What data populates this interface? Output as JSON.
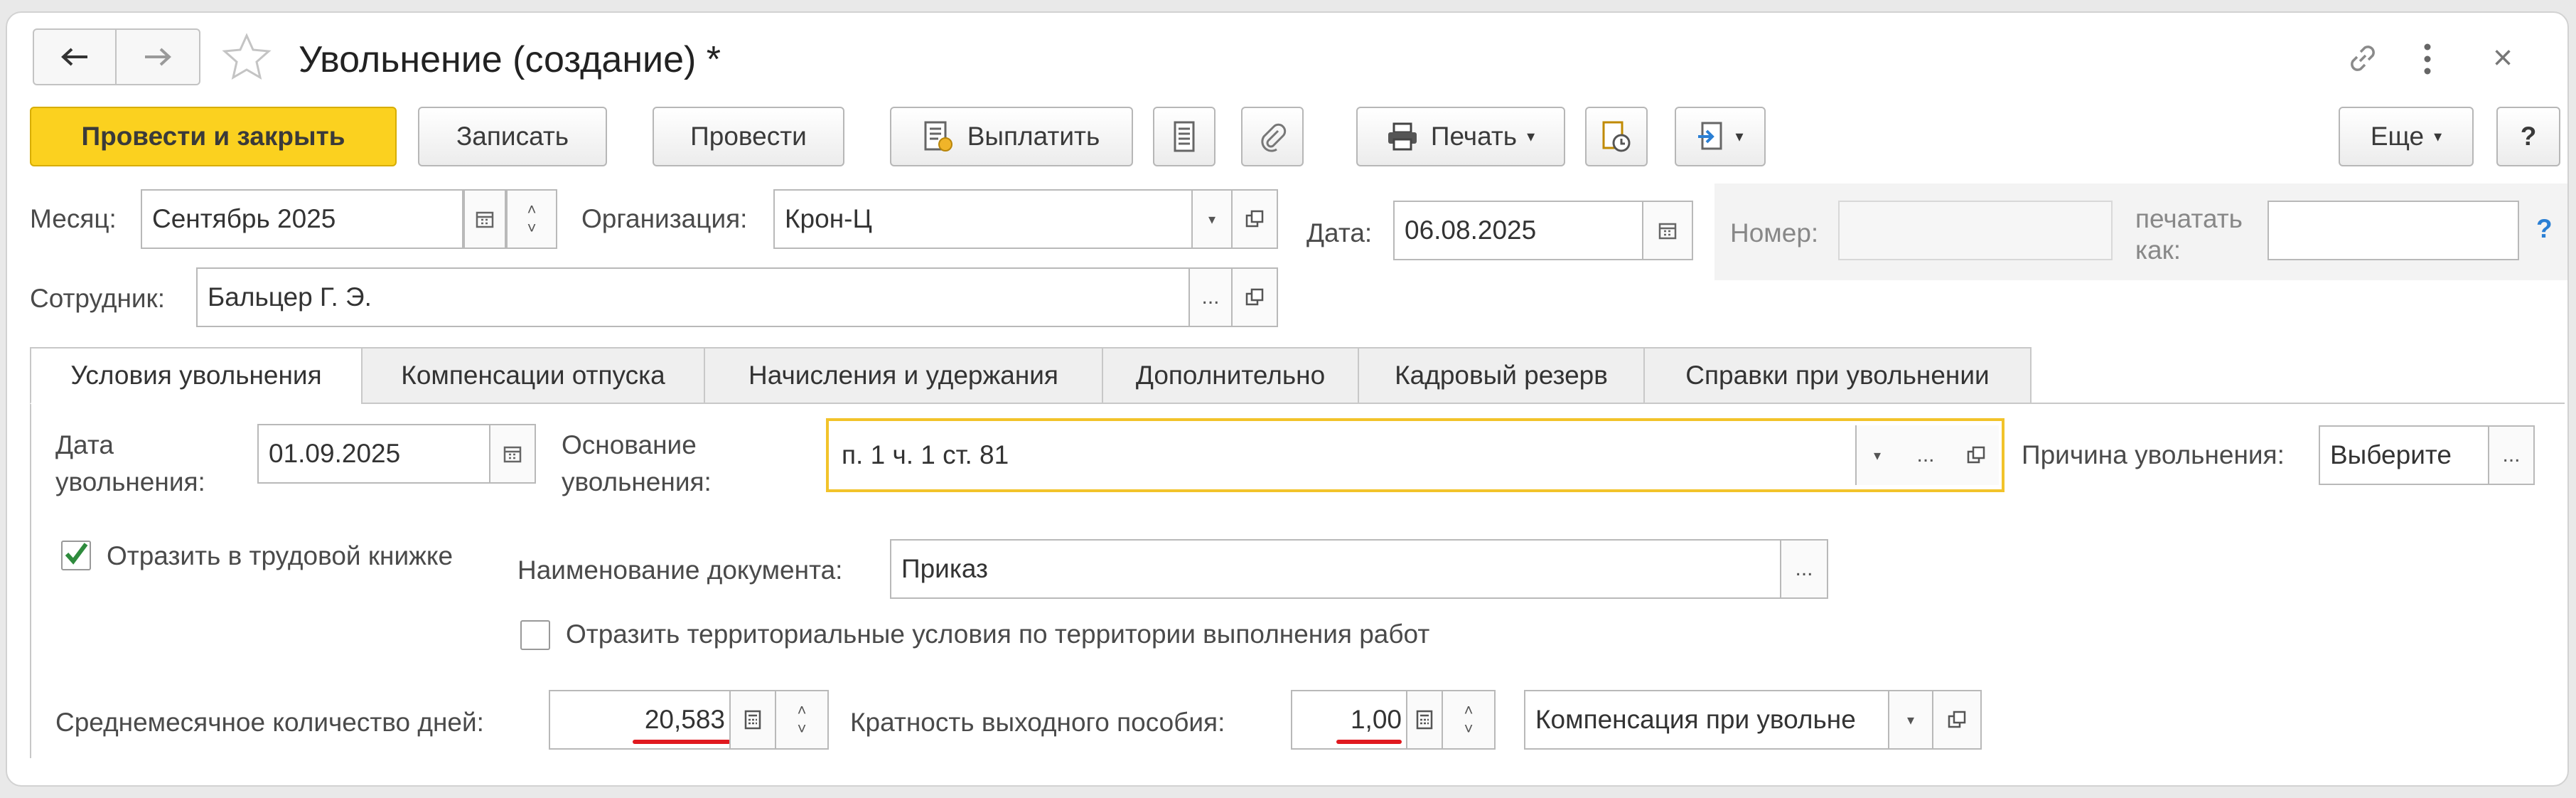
{
  "window": {
    "title": "Увольнение (создание) *",
    "close_symbol": "×"
  },
  "toolbar": {
    "post_and_close": "Провести и закрыть",
    "save": "Записать",
    "post": "Провести",
    "pay": "Выплатить",
    "print": "Печать",
    "more": "Еще",
    "help": "?"
  },
  "header": {
    "month_label": "Месяц:",
    "month_value": "Сентябрь 2025",
    "org_label": "Организация:",
    "org_value": "Крон-Ц",
    "date_label": "Дата:",
    "date_value": "06.08.2025",
    "number_label": "Номер:",
    "number_value": "",
    "print_as_label_1": "печатать",
    "print_as_label_2": "как:",
    "print_as_value": "",
    "help": "?",
    "employee_label": "Сотрудник:",
    "employee_value": "Бальцер Г. Э."
  },
  "tabs": [
    {
      "label": "Условия увольнения"
    },
    {
      "label": "Компенсации отпуска"
    },
    {
      "label": "Начисления и удержания"
    },
    {
      "label": "Дополнительно"
    },
    {
      "label": "Кадровый резерв"
    },
    {
      "label": "Справки при увольнении"
    }
  ],
  "conditions": {
    "dismissal_date_label_1": "Дата",
    "dismissal_date_label_2": "увольнения:",
    "dismissal_date_value": "01.09.2025",
    "basis_label_1": "Основание",
    "basis_label_2": "увольнения:",
    "basis_value": "п. 1 ч. 1 ст. 81",
    "reason_label": "Причина увольнения:",
    "reason_value": "Выберите",
    "workbook_checkbox_label": "Отразить в трудовой книжке",
    "workbook_checked": true,
    "doc_name_label": "Наименование документа:",
    "doc_name_value": "Приказ",
    "territorial_checkbox_label": "Отразить территориальные условия по территории выполнения работ",
    "territorial_checked": false,
    "avg_days_label": "Среднемесячное количество дней:",
    "avg_days_value": "20,583",
    "severance_label": "Кратность выходного пособия:",
    "severance_value": "1,00",
    "compensation_value": "Компенсация при увольне"
  },
  "colors": {
    "primary_button": "#fbd11f",
    "focus_border": "#f2c32a",
    "annotation_underline": "#e0191f",
    "checkmark": "#2e8b3d",
    "help_link": "#2a7fd4"
  }
}
